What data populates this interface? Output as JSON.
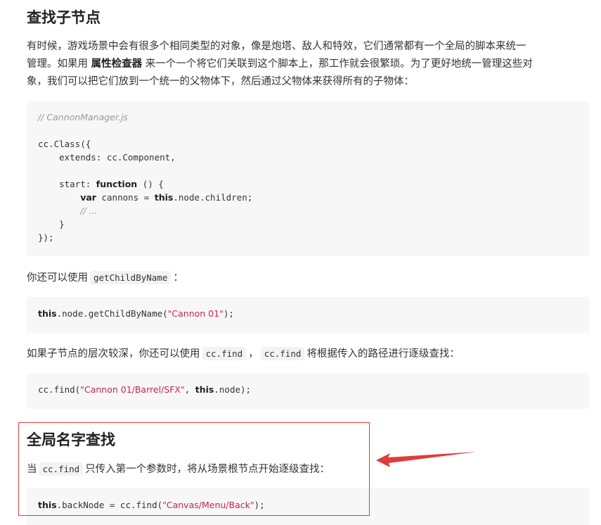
{
  "section1": {
    "title": "查找子节点",
    "intro_p1": "有时候，游戏场景中会有很多个相同类型的对象，像是炮塔、敌人和特效，它们通常都有一个全局的脚本来统一",
    "intro_p2_a": "管理。如果用 ",
    "intro_p2_bold": "属性检查器",
    "intro_p2_b": " 来一个一个将它们关联到这个脚本上，那工作就会很繁琐。为了更好地统一管理这些对",
    "intro_p3": "象，我们可以把它们放到一个统一的父物体下，然后通过父物体来获得所有的子物体：",
    "code1": {
      "comment_file": "// CannonManager.js",
      "l_class": "cc.Class({",
      "l_extends": "    extends: cc.Component,",
      "l_start_a": "    start: ",
      "l_start_kw": "function",
      "l_start_b": " () {",
      "l_var_indent": "        ",
      "l_var_kw": "var",
      "l_var_a": " cannons = ",
      "l_var_this": "this",
      "l_var_b": ".node.children;",
      "l_comment_indent": "        ",
      "l_comment": "// ...",
      "l_close1": "    }",
      "l_close2": "});"
    },
    "p_getchild_a": "你还可以使用",
    "p_getchild_code": "getChildByName",
    "p_getchild_b": "：",
    "code2": {
      "this": "this",
      "a": ".node.getChildByName(",
      "str": "\"Cannon 01\"",
      "b": ");"
    },
    "p_find_a": "如果子节点的层次较深，你还可以使用",
    "p_find_code1": "cc.find",
    "p_find_sep": "，",
    "p_find_code2": "cc.find",
    "p_find_b": "将根据传入的路径进行逐级查找：",
    "code3": {
      "a": "cc.find(",
      "str": "\"Cannon 01/Barrel/SFX\"",
      "b": ", ",
      "this": "this",
      "c": ".node);"
    }
  },
  "section2": {
    "title": "全局名字查找",
    "p_a": "当",
    "p_code": "cc.find",
    "p_b": "只传入第一个参数时，将从场景根节点开始逐级查找：",
    "code4": {
      "this": "this",
      "a": ".backNode = cc.find(",
      "str": "\"Canvas/Menu/Back\"",
      "b": ");"
    }
  },
  "annotation": {
    "box_color": "#e03c3c",
    "arrow_color": "#e03c3c"
  }
}
